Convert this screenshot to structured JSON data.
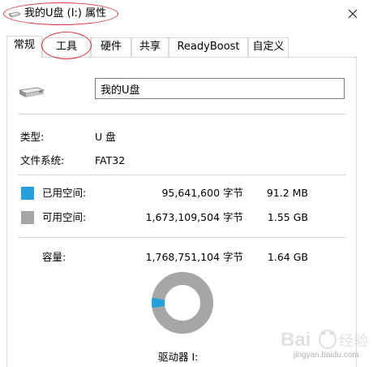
{
  "window": {
    "title": "我的U盘 (I:) 属性",
    "close_icon": "close-icon"
  },
  "tabs": [
    {
      "label": "常规",
      "active": true
    },
    {
      "label": "工具",
      "active": false
    },
    {
      "label": "硬件",
      "active": false
    },
    {
      "label": "共享",
      "active": false
    },
    {
      "label": "ReadyBoost",
      "active": false
    },
    {
      "label": "自定义",
      "active": false
    }
  ],
  "general": {
    "drive_icon": "usb-drive-icon",
    "name_value": "我的U盘",
    "type_label": "类型:",
    "type_value": "U 盘",
    "fs_label": "文件系统:",
    "fs_value": "FAT32",
    "used": {
      "label": "已用空间:",
      "bytes": "95,641,600 字节",
      "size": "91.2 MB",
      "color": "#26a0da"
    },
    "free": {
      "label": "可用空间:",
      "bytes": "1,673,109,504 字节",
      "size": "1.55 GB",
      "color": "#a6a6a6"
    },
    "capacity": {
      "label": "容量:",
      "bytes": "1,768,751,104 字节",
      "size": "1.64 GB"
    },
    "usage_fraction": 0.054,
    "drive_caption": "驱动器 I:"
  },
  "annotations": {
    "highlight_color": "#d8353c"
  },
  "watermark": {
    "text": "jingyan.baidu.com"
  }
}
